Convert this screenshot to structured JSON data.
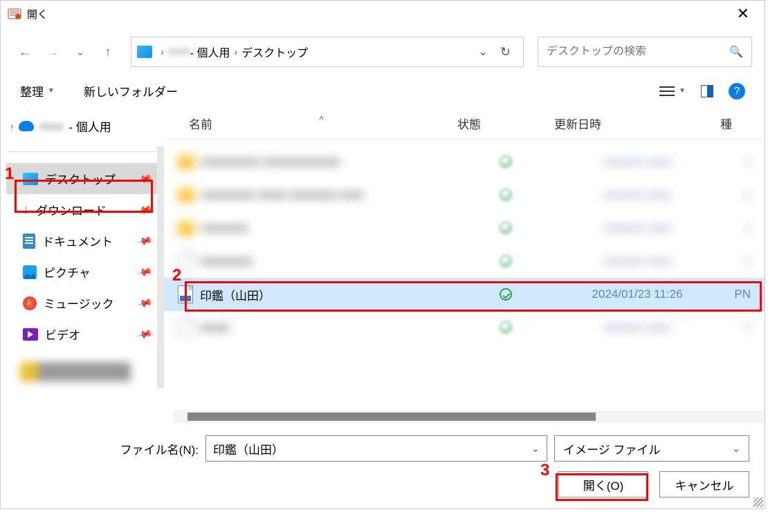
{
  "title": "開く",
  "breadcrumb": {
    "personal": "- 個人用",
    "desktop": "デスクトップ"
  },
  "search": {
    "placeholder": "デスクトップの検索"
  },
  "toolbar": {
    "organize": "整理",
    "newfolder": "新しいフォルダー"
  },
  "sidebar": {
    "top_suffix": "- 個人用",
    "items": [
      {
        "label": "デスクトップ"
      },
      {
        "label": "ダウンロード"
      },
      {
        "label": "ドキュメント"
      },
      {
        "label": "ピクチャ"
      },
      {
        "label": "ミュージック"
      },
      {
        "label": "ビデオ"
      }
    ]
  },
  "columns": {
    "name": "名前",
    "status": "状態",
    "date": "更新日時",
    "type": "種"
  },
  "selected_file": {
    "name": "印鑑（山田）",
    "date": "2024/01/23 11:26",
    "type_abbrev": "PN"
  },
  "footer": {
    "filename_label": "ファイル名(N):",
    "filename_value": "印鑑（山田）",
    "filter": "イメージ ファイル",
    "open": "開く(O)",
    "cancel": "キャンセル"
  },
  "annotations": {
    "n1": "1",
    "n2": "2",
    "n3": "3"
  }
}
